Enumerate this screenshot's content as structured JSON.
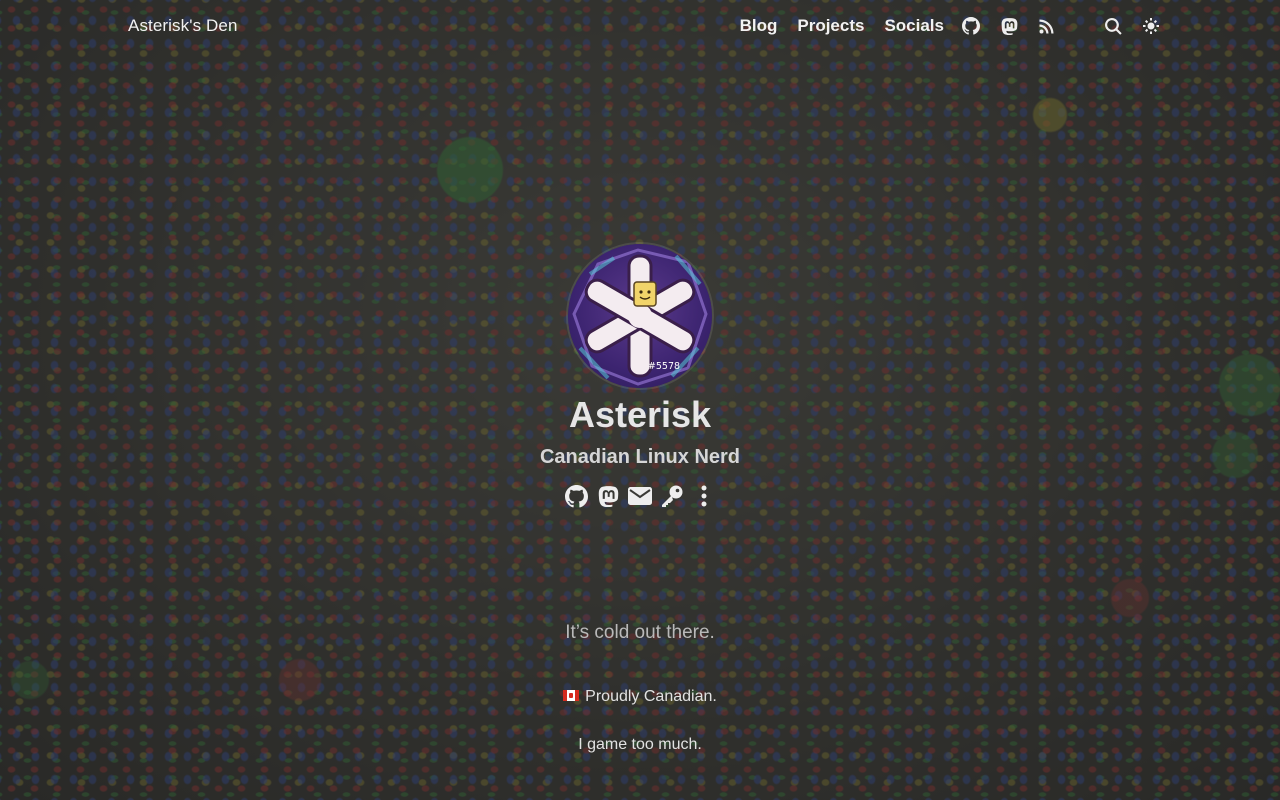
{
  "header": {
    "site_title": "Asterisk's Den",
    "nav": [
      {
        "label": "Blog"
      },
      {
        "label": "Projects"
      },
      {
        "label": "Socials"
      }
    ],
    "icons": [
      "github-icon",
      "mastodon-icon",
      "rss-icon",
      "search-icon",
      "theme-toggle-icon"
    ]
  },
  "profile": {
    "name": "Asterisk",
    "tagline": "Canadian Linux Nerd",
    "avatar_badge": "#5578",
    "social_icons": [
      "github-icon",
      "mastodon-icon",
      "email-icon",
      "key-icon",
      "more-icon"
    ]
  },
  "content": {
    "quote": "It’s cold out there.",
    "lines": [
      {
        "icon": "canada-flag-icon",
        "text": "Proudly Canadian."
      },
      {
        "text": "I game too much."
      }
    ]
  },
  "colors": {
    "text": "#e9e9e9",
    "muted": "#b9b9b9",
    "background_overlay": "#282826"
  }
}
